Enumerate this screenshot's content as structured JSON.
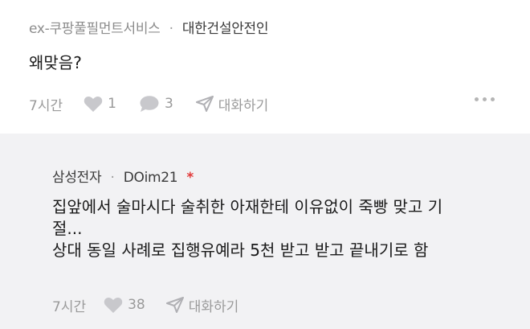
{
  "comment": {
    "nickname": "ex-쿠팡풀필먼트서비스",
    "separator": "·",
    "company": "대한건설안전인",
    "text": "왜맞음?",
    "time": "7시간",
    "likes": "1",
    "replies": "3",
    "chat_label": "대화하기"
  },
  "reply": {
    "nickname": "삼성전자",
    "separator": "·",
    "user": "DOim21",
    "star": "*",
    "lines": [
      "집앞에서 술마시다 술취한 아재한테 이유없이 죽빵 맞고 기",
      "절...",
      "상대 동일 사례로 집행유예라 5천 받고 받고 끝내기로 함"
    ],
    "time": "7시간",
    "likes": "38",
    "chat_label": "대화하기"
  },
  "colors": {
    "reply_bg": "#f2f2f4",
    "muted": "#9a9a9a",
    "accent_star": "#e23a3a"
  }
}
